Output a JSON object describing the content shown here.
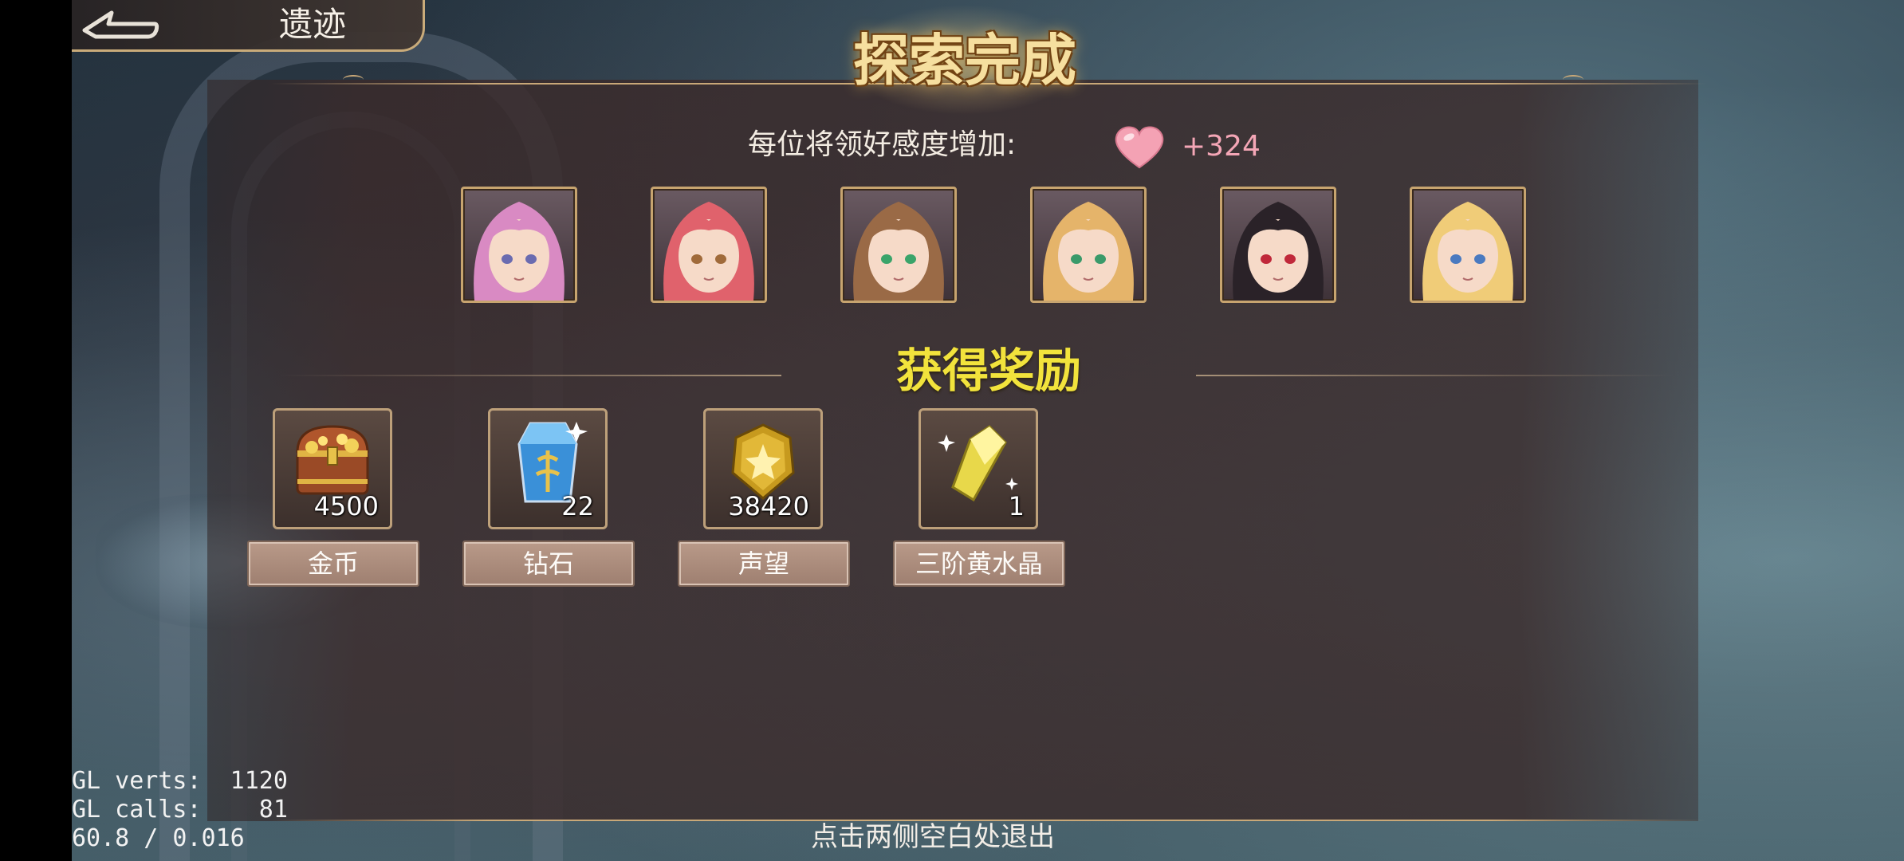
{
  "header": {
    "back_title": "遗迹",
    "main_title": "探索完成"
  },
  "affection": {
    "label": "每位将领好感度增加:",
    "value": "+324"
  },
  "heroes": [
    {
      "name": "hero-pink-hair",
      "hair": "#d98ac3",
      "eye": "#6a6bb0"
    },
    {
      "name": "hero-red-hair",
      "hair": "#e0626c",
      "eye": "#a06a3a"
    },
    {
      "name": "hero-brown-hair",
      "hair": "#9a6a46",
      "eye": "#3aa46a"
    },
    {
      "name": "hero-blonde-hair",
      "hair": "#e5b46a",
      "eye": "#3a9a6a"
    },
    {
      "name": "hero-black-red-hair",
      "hair": "#2a2228",
      "eye": "#c0283a"
    },
    {
      "name": "hero-gold-hair-tiara",
      "hair": "#f0cc78",
      "eye": "#4a7ac0"
    }
  ],
  "rewards": {
    "title": "获得奖励",
    "items": [
      {
        "icon": "treasure-chest-icon",
        "count": "4500",
        "label": "金币"
      },
      {
        "icon": "diamond-crystal-icon",
        "count": "22",
        "label": "钻石"
      },
      {
        "icon": "prestige-medal-icon",
        "count": "38420",
        "label": "声望"
      },
      {
        "icon": "yellow-crystal-icon",
        "count": "1",
        "label": "三阶黄水晶"
      }
    ]
  },
  "exit_hint": "点击两侧空白处退出",
  "debug": {
    "line1": "GL verts:  1120",
    "line2": "GL calls:    81",
    "line3": "60.8 / 0.016"
  },
  "colors": {
    "gold": "#c9a878",
    "reward_title": "#f2e33c",
    "affection_value": "#f4a6b6"
  }
}
